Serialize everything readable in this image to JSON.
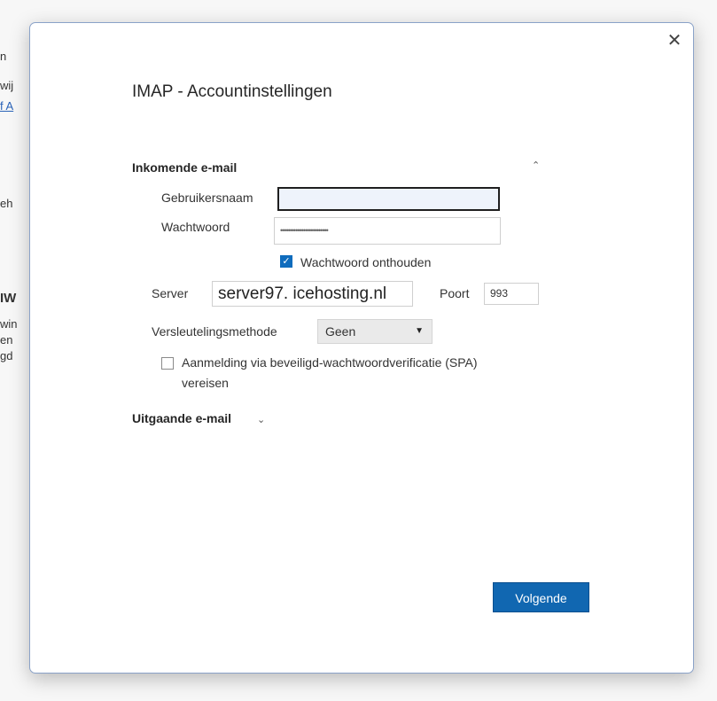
{
  "background": {
    "fragments": [
      "n",
      "wij",
      "f A",
      "eh",
      "IW",
      "win",
      "en",
      "gd"
    ]
  },
  "dialog": {
    "close_glyph": "✕",
    "title": "IMAP - Accountinstellingen",
    "incoming": {
      "section_title": "Inkomende e-mail",
      "collapse_glyph": "⌃",
      "username_label": "Gebruikersnaam",
      "username_value": "",
      "password_label": "Wachtwoord",
      "password_value": "•••••••••••••••••••••••••",
      "remember_label": "Wachtwoord onthouden",
      "remember_checked": true,
      "server_label": "Server",
      "server_value": "server97. icehosting.nl",
      "port_label": "Poort",
      "port_value": "993",
      "encryption_label": "Versleutelingsmethode",
      "encryption_value": "Geen",
      "spa_label_line1": "Aanmelding via beveiligd-wachtwoordverificatie (SPA)",
      "spa_label_line2": "vereisen",
      "spa_checked": false
    },
    "outgoing": {
      "section_title": "Uitgaande e-mail",
      "expand_glyph": "⌄"
    },
    "next_button": "Volgende",
    "accent_color": "#1167b1"
  }
}
